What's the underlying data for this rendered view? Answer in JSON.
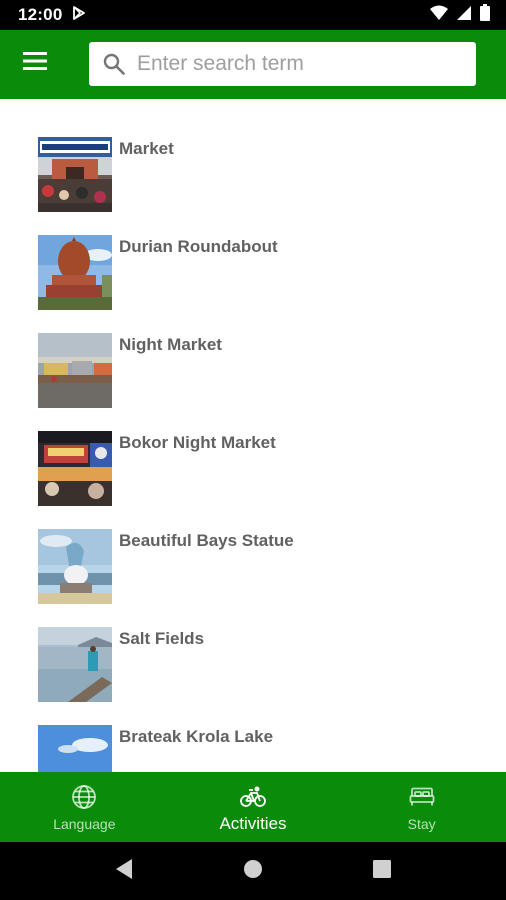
{
  "status_bar": {
    "time": "12:00",
    "icons": [
      "play-store-icon",
      "wifi-icon",
      "cell-signal-icon",
      "battery-icon"
    ]
  },
  "app_bar": {
    "menu_icon": "hamburger-menu-icon",
    "search": {
      "placeholder": "Enter search term",
      "value": "",
      "icon": "search-icon"
    },
    "color": "#0a8c0a"
  },
  "list": {
    "items": [
      {
        "title": "Market",
        "thumbnail": "market-photo"
      },
      {
        "title": "Durian Roundabout",
        "thumbnail": "durian-roundabout-photo"
      },
      {
        "title": "Night Market",
        "thumbnail": "night-market-photo"
      },
      {
        "title": "Bokor Night Market",
        "thumbnail": "bokor-night-market-photo"
      },
      {
        "title": "Beautiful Bays Statue",
        "thumbnail": "beautiful-bays-statue-photo"
      },
      {
        "title": "Salt Fields",
        "thumbnail": "salt-fields-photo"
      },
      {
        "title": "Brateak Krola Lake",
        "thumbnail": "brateak-krola-lake-photo"
      }
    ]
  },
  "bottom_nav": {
    "items": [
      {
        "label": "Language",
        "icon": "globe-icon",
        "active": false
      },
      {
        "label": "Activities",
        "icon": "bicycle-icon",
        "active": true
      },
      {
        "label": "Stay",
        "icon": "bed-icon",
        "active": false
      }
    ]
  },
  "system_nav": {
    "icons": [
      "back-icon",
      "home-icon",
      "recents-icon"
    ]
  }
}
